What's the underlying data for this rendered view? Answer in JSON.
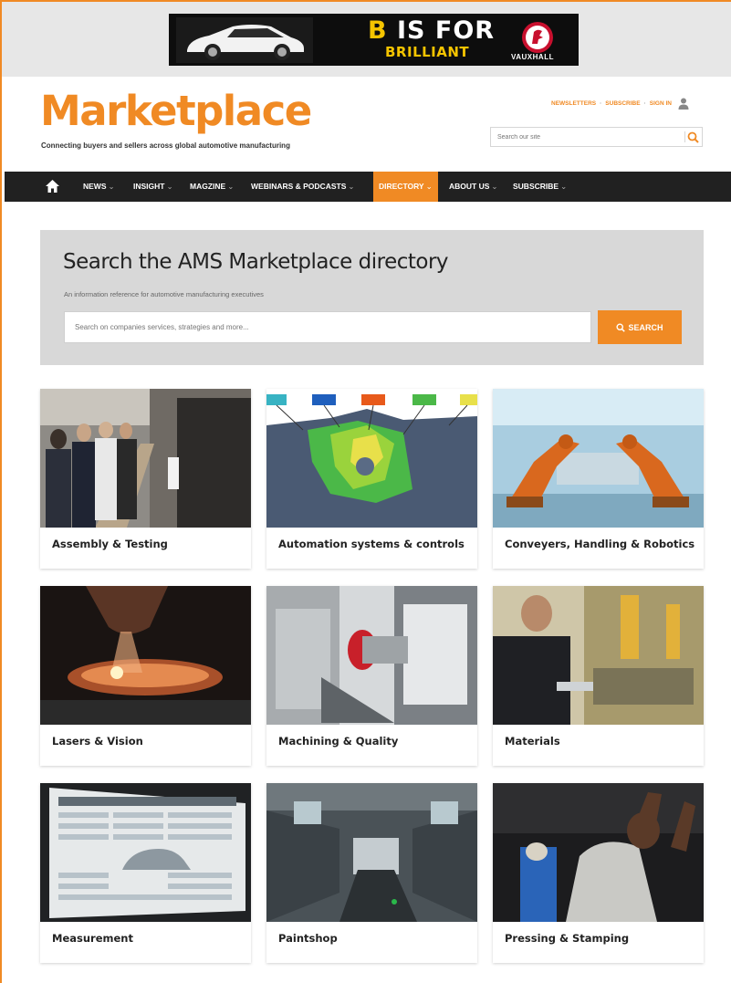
{
  "ad": {
    "headline_b": "B",
    "headline_rest": " IS FOR",
    "subline": "BRILLIANT",
    "brand": "VAUXHALL"
  },
  "header": {
    "logo": "Marketplace",
    "tagline": "Connecting buyers and sellers across global automotive manufacturing",
    "links": [
      "NEWSLETTERS",
      "SUBSCRIBE",
      "SIGN IN"
    ],
    "search_placeholder": "Search our site"
  },
  "nav": {
    "items": [
      "NEWS",
      "INSIGHT",
      "MAGZINE",
      "WEBINARS & PODCASTS",
      "DIRECTORY",
      "ABOUT US",
      "SUBSCRIBE"
    ],
    "active": "DIRECTORY"
  },
  "directory_search": {
    "title": "Search the AMS Marketplace directory",
    "subtitle": "An information reference for automotive manufacturing executives",
    "placeholder": "Search on companies services, strategies and more...",
    "button_label": "SEARCH"
  },
  "categories": [
    {
      "label": "Assembly & Testing"
    },
    {
      "label": "Automation systems & controls"
    },
    {
      "label": "Conveyers, Handling & Robotics"
    },
    {
      "label": "Lasers & Vision"
    },
    {
      "label": "Machining & Quality"
    },
    {
      "label": "Materials"
    },
    {
      "label": "Measurement"
    },
    {
      "label": "Paintshop"
    },
    {
      "label": "Pressing & Stamping"
    }
  ],
  "colors": {
    "accent": "#f08a24",
    "nav_bg": "#212121",
    "panel_bg": "#d8d8d8",
    "ad_yellow": "#f5c400"
  }
}
